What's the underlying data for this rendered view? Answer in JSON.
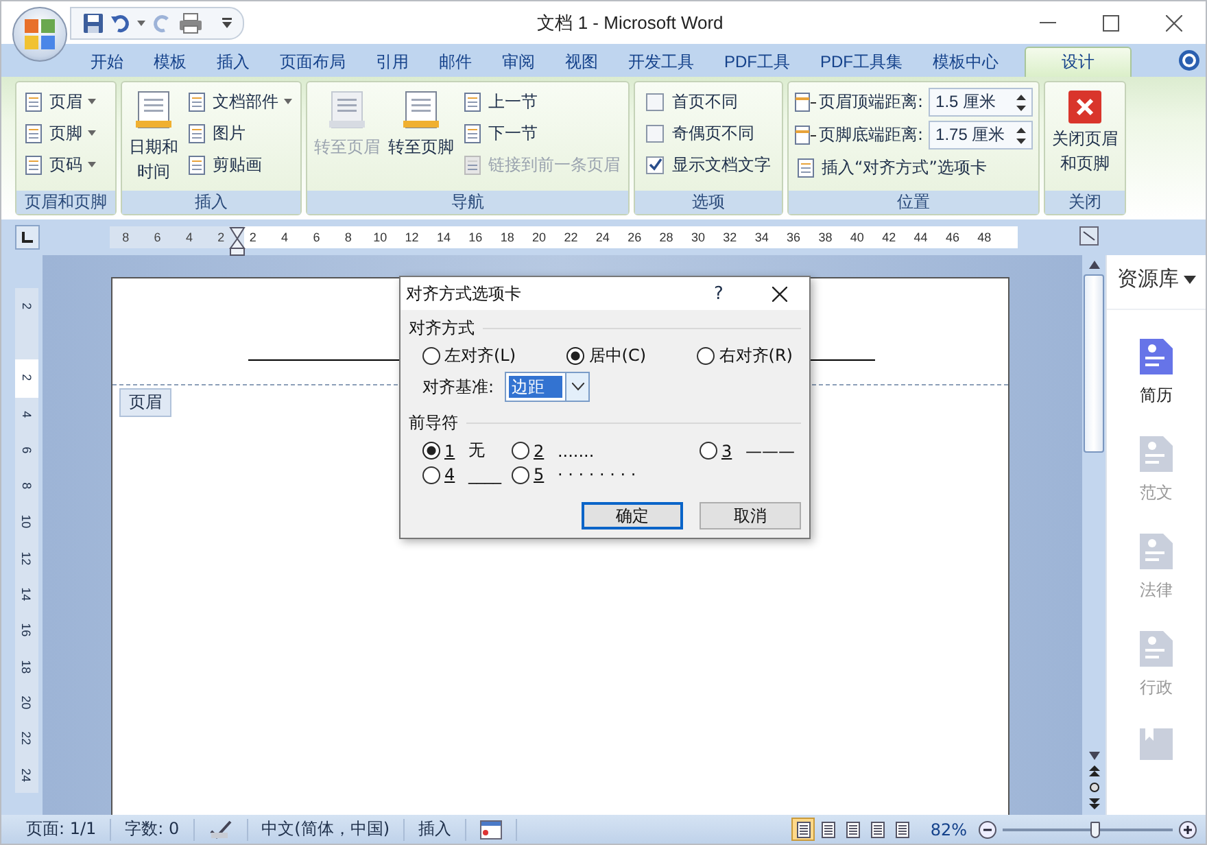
{
  "title_bar": {
    "title": "文档 1 - Microsoft Word"
  },
  "tabs": [
    {
      "label": "开始",
      "selected": false
    },
    {
      "label": "模板",
      "selected": false
    },
    {
      "label": "插入",
      "selected": false
    },
    {
      "label": "页面布局",
      "selected": false
    },
    {
      "label": "引用",
      "selected": false
    },
    {
      "label": "邮件",
      "selected": false
    },
    {
      "label": "审阅",
      "selected": false
    },
    {
      "label": "视图",
      "selected": false
    },
    {
      "label": "开发工具",
      "selected": false
    },
    {
      "label": "PDF工具",
      "selected": false
    },
    {
      "label": "PDF工具集",
      "selected": false
    },
    {
      "label": "模板中心",
      "selected": false
    },
    {
      "label": "设计",
      "selected": true
    }
  ],
  "ribbon": [
    {
      "title": "页眉和页脚",
      "columns": [
        [
          {
            "kind": "small",
            "label": "页眉",
            "dropdown": true,
            "disabled": false
          },
          {
            "kind": "small",
            "label": "页脚",
            "dropdown": true,
            "disabled": false
          },
          {
            "kind": "small",
            "label": "页码",
            "dropdown": true,
            "disabled": false
          }
        ]
      ]
    },
    {
      "title": "插入",
      "columns": [
        [
          {
            "kind": "large",
            "lines": [
              "日期和",
              "时间"
            ],
            "disabled": false
          }
        ],
        [
          {
            "kind": "small",
            "label": "文档部件",
            "dropdown": true,
            "disabled": false
          },
          {
            "kind": "small",
            "label": "图片",
            "dropdown": false,
            "disabled": false
          },
          {
            "kind": "small",
            "label": "剪贴画",
            "dropdown": false,
            "disabled": false
          }
        ]
      ]
    },
    {
      "title": "导航",
      "columns": [
        [
          {
            "kind": "large",
            "lines": [
              "转至页眉"
            ],
            "disabled": true
          }
        ],
        [
          {
            "kind": "large",
            "lines": [
              "转至页脚"
            ],
            "disabled": false
          }
        ],
        [
          {
            "kind": "small",
            "label": "上一节",
            "dropdown": false,
            "disabled": false
          },
          {
            "kind": "small",
            "label": "下一节",
            "dropdown": false,
            "disabled": false
          },
          {
            "kind": "small",
            "label": "链接到前一条页眉",
            "dropdown": false,
            "disabled": true
          }
        ]
      ]
    },
    {
      "title": "选项",
      "columns": [
        [
          {
            "kind": "check",
            "label": "首页不同",
            "checked": false
          },
          {
            "kind": "check",
            "label": "奇偶页不同",
            "checked": false
          },
          {
            "kind": "check",
            "label": "显示文档文字",
            "checked": true
          }
        ]
      ]
    },
    {
      "title": "位置",
      "columns": [
        [
          {
            "kind": "spin",
            "label": "页眉顶端距离:",
            "value": "1.5 厘米"
          },
          {
            "kind": "spin",
            "label": "页脚底端距离:",
            "value": "1.75 厘米"
          },
          {
            "kind": "small",
            "label": "插入“对齐方式”选项卡",
            "dropdown": false,
            "disabled": false
          }
        ]
      ]
    },
    {
      "title": "关闭",
      "columns": [
        [
          {
            "kind": "close",
            "lines": [
              "关闭页眉",
              "和页脚"
            ]
          }
        ]
      ]
    }
  ],
  "ruler": {
    "labels": [
      "8",
      "6",
      "4",
      "2",
      "2",
      "4",
      "6",
      "8",
      "10",
      "12",
      "14",
      "16",
      "18",
      "20",
      "22",
      "24",
      "26",
      "28",
      "30",
      "32",
      "34",
      "36",
      "38",
      "40",
      "42",
      "44",
      "46",
      "48"
    ]
  },
  "vertical_ruler": {
    "labels": [
      "2",
      "2",
      "4",
      "6",
      "8",
      "10",
      "12",
      "14",
      "16",
      "18",
      "20",
      "22",
      "24"
    ]
  },
  "document": {
    "header_tag": "页眉"
  },
  "dialog": {
    "title": "对齐方式选项卡",
    "help": "?",
    "alignment": {
      "legend": "对齐方式",
      "options": [
        {
          "label": "左对齐(L)",
          "selected": false
        },
        {
          "label": "居中(C)",
          "selected": true
        },
        {
          "label": "右对齐(R)",
          "selected": false
        }
      ],
      "basis_label": "对齐基准:",
      "basis_value": "边距"
    },
    "leader": {
      "legend": "前导符",
      "options": [
        {
          "number": "1",
          "sample": "无",
          "selected": true
        },
        {
          "number": "2",
          "sample": ".......",
          "selected": false
        },
        {
          "number": "3",
          "sample": "———",
          "selected": false
        },
        {
          "number": "4",
          "sample": "____",
          "selected": false
        },
        {
          "number": "5",
          "sample": "· · · · · · · ·",
          "selected": false
        }
      ]
    },
    "buttons": [
      {
        "label": "确定",
        "default": true
      },
      {
        "label": "取消",
        "default": false
      }
    ]
  },
  "side_panel": {
    "title": "资源库",
    "items": [
      {
        "label": "简历",
        "selected": true
      },
      {
        "label": "范文",
        "selected": false
      },
      {
        "label": "法律",
        "selected": false
      },
      {
        "label": "行政",
        "selected": false
      }
    ]
  },
  "status_bar": {
    "items": [
      {
        "kind": "text",
        "label": "页面: 1/1"
      },
      {
        "kind": "text",
        "label": "字数: 0"
      },
      {
        "kind": "proofing"
      },
      {
        "kind": "text",
        "label": "中文(简体，中国)"
      },
      {
        "kind": "text",
        "label": "插入"
      },
      {
        "kind": "macro"
      }
    ],
    "views": [
      {
        "selected": true
      },
      {
        "selected": false
      },
      {
        "selected": false
      },
      {
        "selected": false
      },
      {
        "selected": false
      }
    ],
    "zoom": {
      "percent": "82%",
      "level": 0.54
    }
  }
}
